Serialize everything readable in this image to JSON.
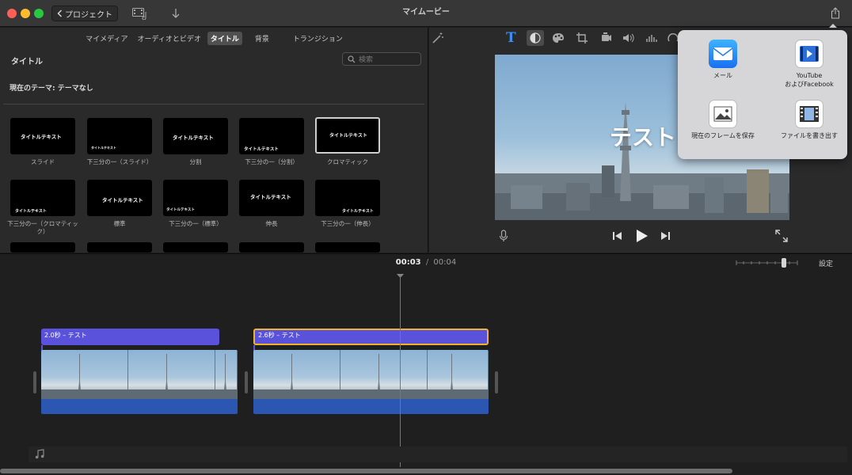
{
  "window": {
    "title": "マイムービー"
  },
  "toolbar": {
    "back_label": "プロジェクト"
  },
  "browser": {
    "tabs": [
      {
        "label": "マイメディア",
        "active": false
      },
      {
        "label": "オーディオとビデオ",
        "active": false
      },
      {
        "label": "タイトル",
        "active": true
      },
      {
        "label": "背景",
        "active": false
      },
      {
        "label": "トランジション",
        "active": false
      }
    ],
    "section_label": "タイトル",
    "search_placeholder": "検索",
    "theme_label": "現在のテーマ: テーマなし",
    "tiles": [
      {
        "label": "スライド",
        "sample": "タイトルテキスト",
        "selected": false
      },
      {
        "label": "下三分の一（スライド）",
        "sample": "タイトルテキスト",
        "selected": false
      },
      {
        "label": "分割",
        "sample": "タイトルテキスト",
        "selected": false
      },
      {
        "label": "下三分の一（分割）",
        "sample": "タイトルテキスト",
        "selected": false
      },
      {
        "label": "クロマティック",
        "sample": "タイトルテキスト",
        "selected": true
      },
      {
        "label": "下三分の一（クロマティック）",
        "sample": "タイトルテキスト",
        "selected": false
      },
      {
        "label": "標準",
        "sample": "タイトルテキスト",
        "selected": false
      },
      {
        "label": "下三分の一（標準）",
        "sample": "タイトルテキスト",
        "selected": false
      },
      {
        "label": "伸長",
        "sample": "タイトルテキスト",
        "selected": false
      },
      {
        "label": "下三分の一（伸長）",
        "sample": "タイトルテキスト",
        "selected": false
      }
    ]
  },
  "viewer": {
    "overlay_text": "テスト"
  },
  "timeline": {
    "current_time": "00:03",
    "separator": "/",
    "total_time": "00:04",
    "settings_label": "設定",
    "title_clips": [
      {
        "label": "2.0秒 – テスト",
        "selected": false
      },
      {
        "label": "2.6秒 – テスト",
        "selected": true
      }
    ]
  },
  "share_menu": {
    "items": [
      {
        "label": "メール",
        "icon": "mail-icon"
      },
      {
        "label": "YouTube\nおよびFacebook",
        "icon": "youtube-facebook-icon"
      },
      {
        "label": "現在のフレームを保存",
        "icon": "save-frame-icon"
      },
      {
        "label": "ファイルを書き出す",
        "icon": "export-file-icon"
      }
    ]
  },
  "colors": {
    "accent_blue": "#3d8ff5",
    "title_clip": "#5b52dc",
    "selection": "#f0b429",
    "audio_track": "#2b56b2"
  }
}
